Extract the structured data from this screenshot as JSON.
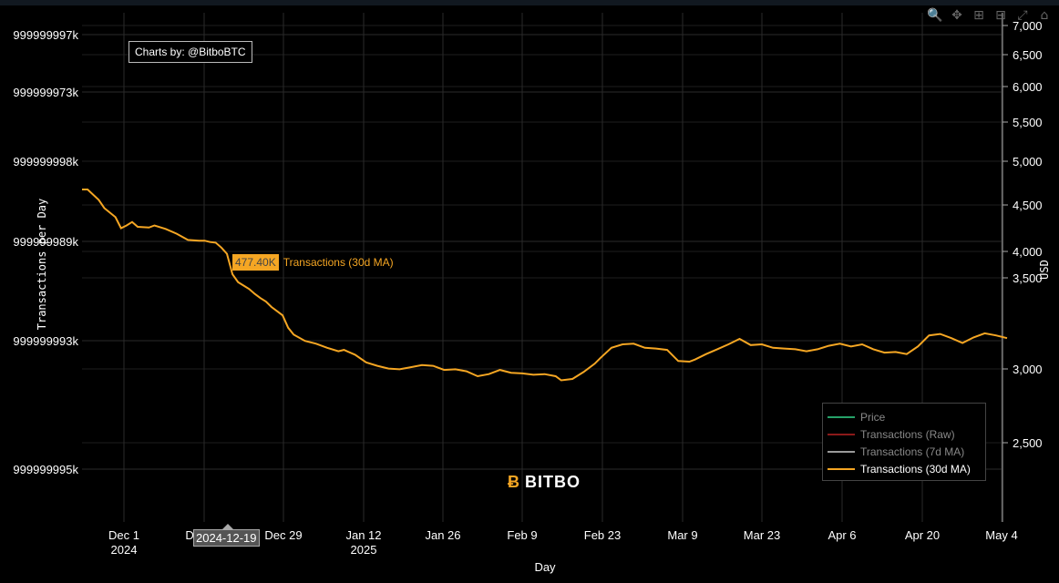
{
  "credit": "Charts by: @BitboBTC",
  "logo_text": "BITBO",
  "hover": {
    "x_label": "2024-12-19",
    "value_label": "477.40K",
    "series_label": "Transactions (30d MA)"
  },
  "modebar": [
    "zoom-icon",
    "pan-icon",
    "zoom-in-icon",
    "zoom-out-icon",
    "autoscale-icon",
    "home-icon"
  ],
  "colors": {
    "price": "#26a269",
    "raw": "#8b1a1a",
    "ma7": "#9a9a9a",
    "ma30": "#f5a623"
  },
  "legend": [
    {
      "name": "Price",
      "color": "#26a269",
      "active": false
    },
    {
      "name": "Transactions (Raw)",
      "color": "#8b1a1a",
      "active": false
    },
    {
      "name": "Transactions (7d MA)",
      "color": "#9a9a9a",
      "active": false
    },
    {
      "name": "Transactions (30d MA)",
      "color": "#f5a623",
      "active": true
    }
  ],
  "chart_data": {
    "type": "line",
    "xlabel": "Day",
    "ylabel": "Transactions per Day",
    "y2label": "USD",
    "x_ticks": [
      "Dec 1\n2024",
      "Dec 15",
      "Dec 29",
      "Jan 12\n2025",
      "Jan 26",
      "Feb 9",
      "Feb 23",
      "Mar 9",
      "Mar 23",
      "Apr 6",
      "Apr 20",
      "May 4"
    ],
    "y_ticks_left": [
      "999999997k",
      "999999973k",
      "999999998k",
      "999999989k",
      "999999993k",
      "999999995k"
    ],
    "y_ticks_right": [
      "7,000",
      "6,500",
      "6,000",
      "5,500",
      "5,000",
      "4,500",
      "4,000",
      "3,500",
      "3,000",
      "2,500"
    ],
    "series": [
      {
        "name": "Transactions (30d MA)",
        "color": "#f5a623",
        "points": [
          [
            "2024-11-22",
            600
          ],
          [
            "2024-11-23",
            600
          ],
          [
            "2024-11-25",
            585
          ],
          [
            "2024-11-26",
            573
          ],
          [
            "2024-11-28",
            560
          ],
          [
            "2024-11-29",
            544
          ],
          [
            "2024-11-30",
            548
          ],
          [
            "2024-12-01",
            553
          ],
          [
            "2024-12-02",
            546
          ],
          [
            "2024-12-04",
            545
          ],
          [
            "2024-12-05",
            548
          ],
          [
            "2024-12-07",
            543
          ],
          [
            "2024-12-09",
            536
          ],
          [
            "2024-12-11",
            527
          ],
          [
            "2024-12-13",
            526
          ],
          [
            "2024-12-14",
            526
          ],
          [
            "2024-12-15",
            524
          ],
          [
            "2024-12-16",
            523
          ],
          [
            "2024-12-17",
            516
          ],
          [
            "2024-12-18",
            507
          ],
          [
            "2024-12-19",
            477.4
          ],
          [
            "2024-12-20",
            466
          ],
          [
            "2024-12-21",
            461
          ],
          [
            "2024-12-22",
            456
          ],
          [
            "2024-12-23",
            449
          ],
          [
            "2024-12-24",
            443
          ],
          [
            "2024-12-25",
            438
          ],
          [
            "2024-12-26",
            430
          ],
          [
            "2024-12-27",
            424
          ],
          [
            "2024-12-28",
            418
          ],
          [
            "2024-12-29",
            400
          ],
          [
            "2024-12-30",
            390
          ],
          [
            "2025-01-01",
            381
          ],
          [
            "2025-01-03",
            377
          ],
          [
            "2025-01-05",
            371
          ],
          [
            "2025-01-07",
            366
          ],
          [
            "2025-01-08",
            368
          ],
          [
            "2025-01-10",
            361
          ],
          [
            "2025-01-12",
            350
          ],
          [
            "2025-01-14",
            345
          ],
          [
            "2025-01-16",
            341
          ],
          [
            "2025-01-18",
            340
          ],
          [
            "2025-01-20",
            343
          ],
          [
            "2025-01-22",
            346
          ],
          [
            "2025-01-24",
            345
          ],
          [
            "2025-01-26",
            339
          ],
          [
            "2025-01-28",
            340
          ],
          [
            "2025-01-30",
            337
          ],
          [
            "2025-02-01",
            330
          ],
          [
            "2025-02-03",
            333
          ],
          [
            "2025-02-05",
            339
          ],
          [
            "2025-02-07",
            335
          ],
          [
            "2025-02-09",
            334
          ],
          [
            "2025-02-11",
            332
          ],
          [
            "2025-02-13",
            333
          ],
          [
            "2025-02-15",
            330
          ],
          [
            "2025-02-16",
            324
          ],
          [
            "2025-02-18",
            326
          ],
          [
            "2025-02-20",
            336
          ],
          [
            "2025-02-22",
            348
          ],
          [
            "2025-02-23",
            356
          ],
          [
            "2025-02-25",
            371
          ],
          [
            "2025-02-27",
            376
          ],
          [
            "2025-03-01",
            377
          ],
          [
            "2025-03-03",
            371
          ],
          [
            "2025-03-05",
            370
          ],
          [
            "2025-03-07",
            368
          ],
          [
            "2025-03-09",
            352
          ],
          [
            "2025-03-11",
            351
          ],
          [
            "2025-03-12",
            354
          ],
          [
            "2025-03-14",
            362
          ],
          [
            "2025-03-16",
            369
          ],
          [
            "2025-03-18",
            376
          ],
          [
            "2025-03-20",
            384
          ],
          [
            "2025-03-22",
            375
          ],
          [
            "2025-03-24",
            376
          ],
          [
            "2025-03-26",
            371
          ],
          [
            "2025-03-28",
            370
          ],
          [
            "2025-03-30",
            369
          ],
          [
            "2025-04-01",
            366
          ],
          [
            "2025-04-03",
            369
          ],
          [
            "2025-04-05",
            374
          ],
          [
            "2025-04-07",
            377
          ],
          [
            "2025-04-09",
            373
          ],
          [
            "2025-04-11",
            376
          ],
          [
            "2025-04-13",
            369
          ],
          [
            "2025-04-15",
            364
          ],
          [
            "2025-04-17",
            365
          ],
          [
            "2025-04-19",
            362
          ],
          [
            "2025-04-21",
            373
          ],
          [
            "2025-04-23",
            389
          ],
          [
            "2025-04-25",
            391
          ],
          [
            "2025-04-27",
            385
          ],
          [
            "2025-04-29",
            378
          ],
          [
            "2025-05-01",
            386
          ],
          [
            "2025-05-03",
            392
          ],
          [
            "2025-05-05",
            389
          ],
          [
            "2025-05-07",
            385
          ]
        ]
      }
    ],
    "grid": true,
    "legend_position": "bottom-right"
  }
}
